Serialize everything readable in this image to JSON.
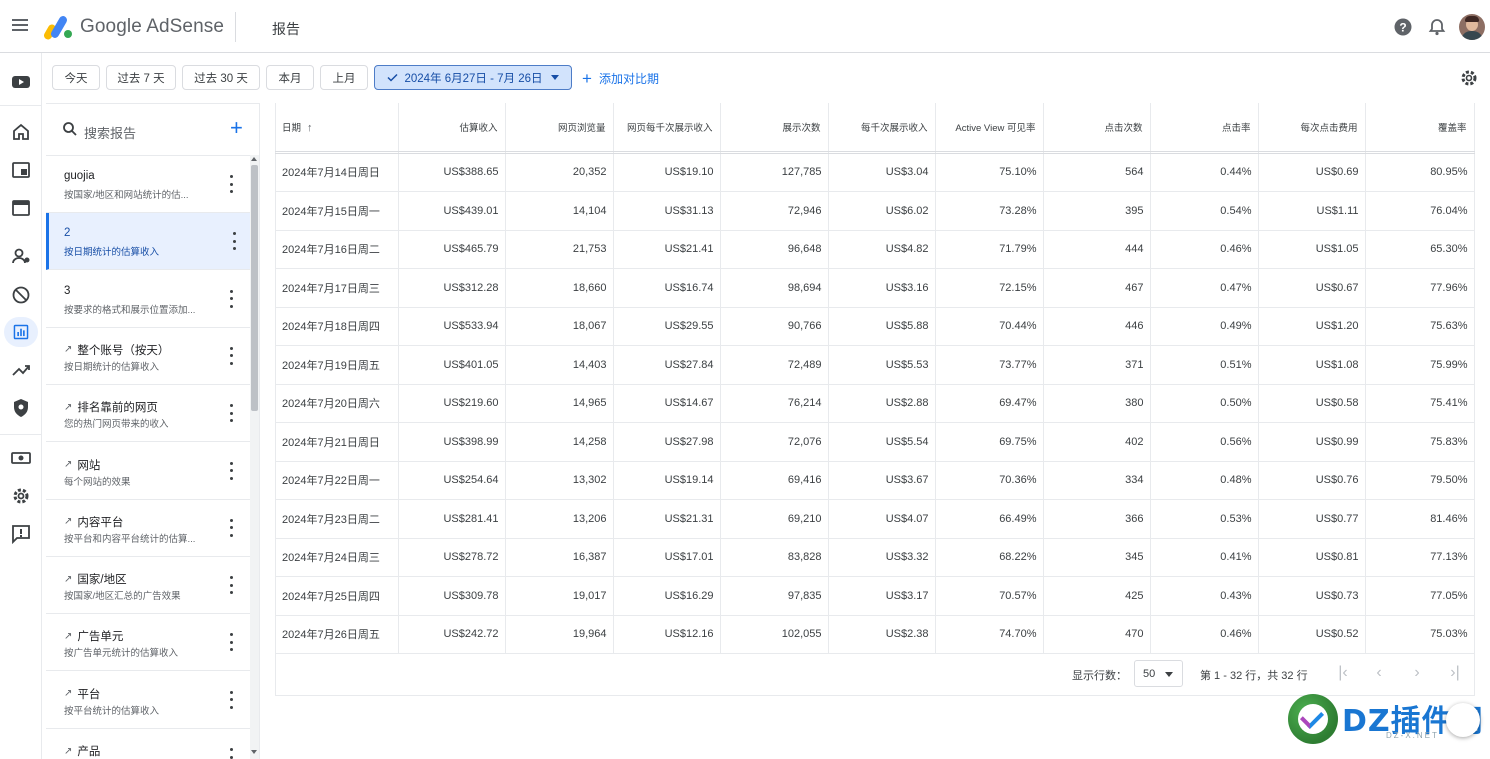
{
  "app": {
    "logo_text": "Google AdSense",
    "page_title": "报告"
  },
  "filters": {
    "chips": [
      "今天",
      "过去 7 天",
      "过去 30 天",
      "本月",
      "上月"
    ],
    "date_range": "2024年 6月27日 - 7月 26日",
    "compare": "添加对比期"
  },
  "sidebar": {
    "search_placeholder": "搜索报告",
    "items": [
      {
        "title": "guojia",
        "subtitle": "按国家/地区和网站统计的估...",
        "trend": false
      },
      {
        "title": "2",
        "subtitle": "按日期统计的估算收入",
        "trend": false
      },
      {
        "title": "3",
        "subtitle": "按要求的格式和展示位置添加...",
        "trend": false
      },
      {
        "title": "整个账号（按天）",
        "subtitle": "按日期统计的估算收入",
        "trend": true
      },
      {
        "title": "排名靠前的网页",
        "subtitle": "您的热门网页带来的收入",
        "trend": true
      },
      {
        "title": "网站",
        "subtitle": "每个网站的效果",
        "trend": true
      },
      {
        "title": "内容平台",
        "subtitle": "按平台和内容平台统计的估算...",
        "trend": true
      },
      {
        "title": "国家/地区",
        "subtitle": "按国家/地区汇总的广告效果",
        "trend": true
      },
      {
        "title": "广告单元",
        "subtitle": "按广告单元统计的估算收入",
        "trend": true
      },
      {
        "title": "平台",
        "subtitle": "按平台统计的估算收入",
        "trend": true
      },
      {
        "title": "产品",
        "subtitle": "",
        "trend": true
      }
    ]
  },
  "table": {
    "headers": [
      "日期",
      "估算收入",
      "网页浏览量",
      "网页每千次展示收入",
      "展示次数",
      "每千次展示收入",
      "Active View 可见率",
      "点击次数",
      "点击率",
      "每次点击费用",
      "覆盖率"
    ],
    "rows": [
      [
        "2024年7月14日周日",
        "US$388.65",
        "20,352",
        "US$19.10",
        "127,785",
        "US$3.04",
        "75.10%",
        "564",
        "0.44%",
        "US$0.69",
        "80.95%"
      ],
      [
        "2024年7月15日周一",
        "US$439.01",
        "14,104",
        "US$31.13",
        "72,946",
        "US$6.02",
        "73.28%",
        "395",
        "0.54%",
        "US$1.11",
        "76.04%"
      ],
      [
        "2024年7月16日周二",
        "US$465.79",
        "21,753",
        "US$21.41",
        "96,648",
        "US$4.82",
        "71.79%",
        "444",
        "0.46%",
        "US$1.05",
        "65.30%"
      ],
      [
        "2024年7月17日周三",
        "US$312.28",
        "18,660",
        "US$16.74",
        "98,694",
        "US$3.16",
        "72.15%",
        "467",
        "0.47%",
        "US$0.67",
        "77.96%"
      ],
      [
        "2024年7月18日周四",
        "US$533.94",
        "18,067",
        "US$29.55",
        "90,766",
        "US$5.88",
        "70.44%",
        "446",
        "0.49%",
        "US$1.20",
        "75.63%"
      ],
      [
        "2024年7月19日周五",
        "US$401.05",
        "14,403",
        "US$27.84",
        "72,489",
        "US$5.53",
        "73.77%",
        "371",
        "0.51%",
        "US$1.08",
        "75.99%"
      ],
      [
        "2024年7月20日周六",
        "US$219.60",
        "14,965",
        "US$14.67",
        "76,214",
        "US$2.88",
        "69.47%",
        "380",
        "0.50%",
        "US$0.58",
        "75.41%"
      ],
      [
        "2024年7月21日周日",
        "US$398.99",
        "14,258",
        "US$27.98",
        "72,076",
        "US$5.54",
        "69.75%",
        "402",
        "0.56%",
        "US$0.99",
        "75.83%"
      ],
      [
        "2024年7月22日周一",
        "US$254.64",
        "13,302",
        "US$19.14",
        "69,416",
        "US$3.67",
        "70.36%",
        "334",
        "0.48%",
        "US$0.76",
        "79.50%"
      ],
      [
        "2024年7月23日周二",
        "US$281.41",
        "13,206",
        "US$21.31",
        "69,210",
        "US$4.07",
        "66.49%",
        "366",
        "0.53%",
        "US$0.77",
        "81.46%"
      ],
      [
        "2024年7月24日周三",
        "US$278.72",
        "16,387",
        "US$17.01",
        "83,828",
        "US$3.32",
        "68.22%",
        "345",
        "0.41%",
        "US$0.81",
        "77.13%"
      ],
      [
        "2024年7月25日周四",
        "US$309.78",
        "19,017",
        "US$16.29",
        "97,835",
        "US$3.17",
        "70.57%",
        "425",
        "0.43%",
        "US$0.73",
        "77.05%"
      ],
      [
        "2024年7月26日周五",
        "US$242.72",
        "19,964",
        "US$12.16",
        "102,055",
        "US$2.38",
        "74.70%",
        "470",
        "0.46%",
        "US$0.52",
        "75.03%"
      ]
    ]
  },
  "pagination": {
    "rows_label": "显示行数：",
    "rows_value": "50",
    "range_text": "第 1 - 32 行，共 32 行"
  },
  "watermark": {
    "text": "DZ插件网",
    "sub": "DZ-X.NET"
  },
  "colors": {
    "accent": "#1a73e8",
    "selected_bg": "#d2e3fc"
  },
  "icons": [
    "menu-icon",
    "adsense-logo-icon",
    "help-icon",
    "bell-icon",
    "avatar",
    "youtube-icon",
    "home-icon",
    "sites-icon",
    "ads-icon",
    "account-icon",
    "block-icon",
    "reports-icon",
    "optimize-icon",
    "policy-icon",
    "payments-icon",
    "settings-icon",
    "feedback-icon",
    "search-icon",
    "add-icon",
    "more-vert-icon",
    "trend-icon",
    "sort-arrow-icon",
    "first-page-icon",
    "prev-page-icon",
    "next-page-icon",
    "last-page-icon"
  ]
}
